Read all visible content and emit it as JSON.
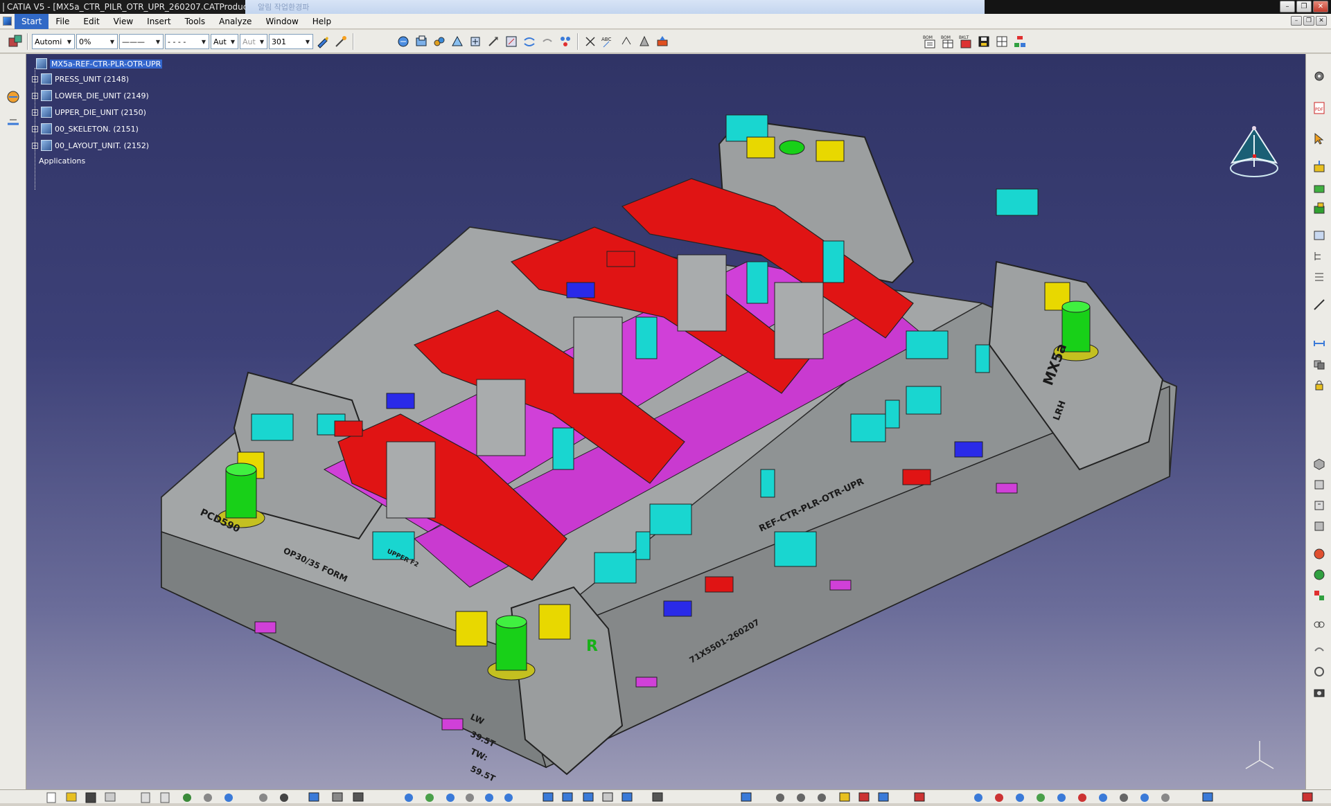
{
  "window": {
    "title": "CATIA V5 - [MX5a_CTR_PILR_OTR_UPR_260207.CATProduct]",
    "title_ghost": "알림 작업환경파"
  },
  "menu": [
    "Start",
    "File",
    "Edit",
    "View",
    "Insert",
    "Tools",
    "Analyze",
    "Window",
    "Help"
  ],
  "toolbar": {
    "color_combo": "Automi",
    "transparency_combo": "0%",
    "linetype_combo": "———",
    "linestyle_combo": "- - - -",
    "weight_combo": "Aut",
    "layer_combo": "Aut",
    "number_combo": "301",
    "bom_labels": [
      "BOM",
      "BOM",
      "BKLT"
    ]
  },
  "tree": {
    "root": "MX5a-REF-CTR-PLR-OTR-UPR",
    "children": [
      "PRESS_UNIT (2148)",
      "LOWER_DIE_UNIT (2149)",
      "UPPER_DIE_UNIT (2150)",
      "00_SKELETON. (2151)",
      "00_LAYOUT_UNIT. (2152)"
    ],
    "applications": "Applications"
  },
  "model_labels": {
    "rear_text": "MX5a",
    "rear_text2": "LRH",
    "front_left": "PCD590",
    "front_left2": "OP30/35 FORM",
    "front_right": "REF-CTR-PLR-OTR-UPR",
    "weight_lines": [
      "LW",
      "39.5T",
      "TW:",
      "59.5T"
    ],
    "right_label": "R",
    "part_no": "71X5501-260207",
    "upper_f": "UPPER F2"
  },
  "colors": {
    "viewport_top": "#303466",
    "viewport_bottom": "#9d9cb7",
    "die_gray": "#9a9d9e",
    "red": "#e01010",
    "cyan": "#19d6d0",
    "magenta": "#e040e0",
    "yellow": "#e8d800",
    "green": "#18d018",
    "selection": "#3366cc"
  }
}
